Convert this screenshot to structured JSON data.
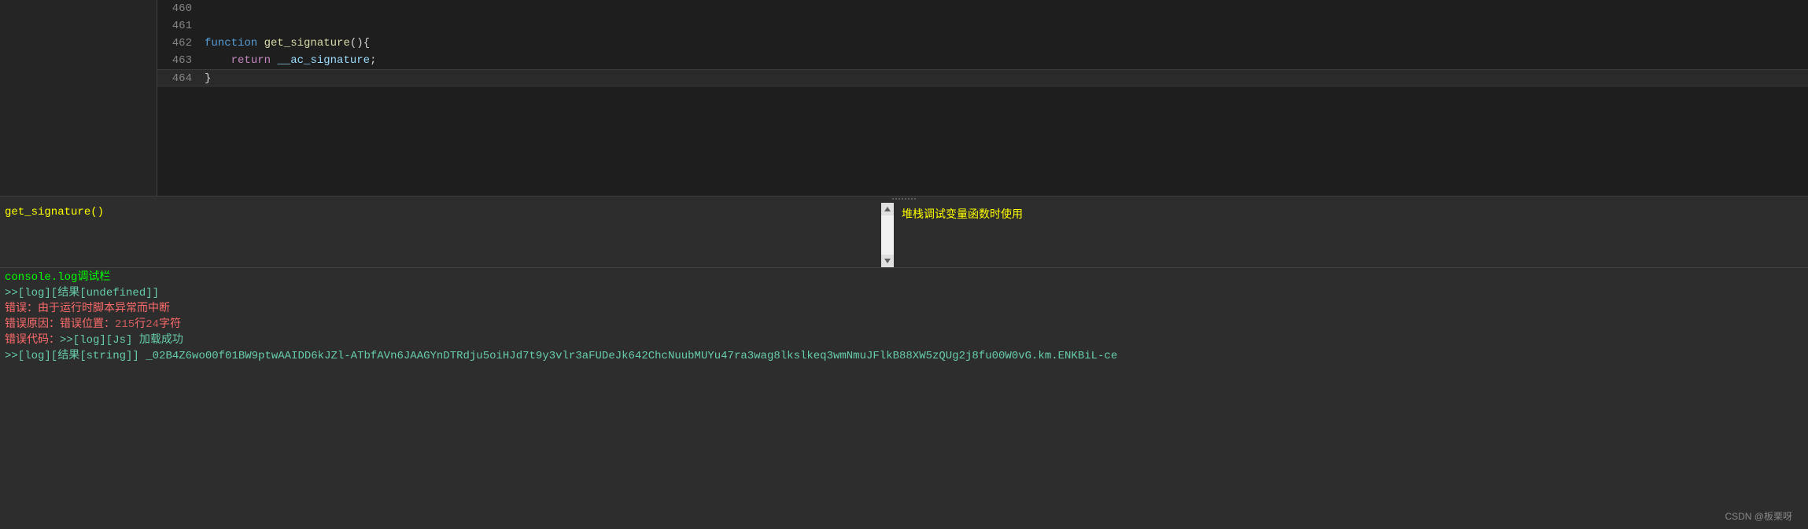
{
  "editor": {
    "lines": [
      {
        "num": "460",
        "content": ""
      },
      {
        "num": "461",
        "content": ""
      },
      {
        "num": "462",
        "tokens": [
          {
            "text": "function",
            "cls": "keyword"
          },
          {
            "text": " ",
            "cls": "punctuation"
          },
          {
            "text": "get_signature",
            "cls": "function-name"
          },
          {
            "text": "(){",
            "cls": "punctuation"
          }
        ]
      },
      {
        "num": "463",
        "tokens": [
          {
            "text": "    ",
            "cls": "punctuation"
          },
          {
            "text": "return",
            "cls": "return-keyword"
          },
          {
            "text": " ",
            "cls": "punctuation"
          },
          {
            "text": "__ac_signature",
            "cls": "identifier"
          },
          {
            "text": ";",
            "cls": "punctuation"
          }
        ]
      },
      {
        "num": "464",
        "tokens": [
          {
            "text": "}",
            "cls": "punctuation"
          }
        ],
        "highlighted": true
      }
    ]
  },
  "input_panel": {
    "value": "get_signature()"
  },
  "info_panel": {
    "text": "堆栈调试变量函数时使用"
  },
  "console": {
    "title": "console.log调试栏",
    "lines": [
      {
        "type": "log",
        "prefix": ">>[log][结果[undefined]]"
      },
      {
        "type": "error",
        "text": "错误：由于运行时脚本异常而中断"
      },
      {
        "type": "error",
        "prefix": "错误原因：错误位置：",
        "highlight": "215",
        "middle": "行",
        "highlight2": "24",
        "suffix": "字符"
      },
      {
        "type": "mixed",
        "prefix": "错误代码：",
        "log": ">>[log][Js] 加载成功"
      },
      {
        "type": "log",
        "prefix": ">>[log][结果[string]] ",
        "value": "_02B4Z6wo00f01BW9ptwAAIDD6kJZl-ATbfAVn6JAAGYnDTRdju5oiHJd7t9y3vlr3aFUDeJk642ChcNuubMUYu47ra3wag8lkslkeq3wmNmuJFlkB88XW5zQUg2j8fu00W0vG.km.ENKBiL-ce"
      }
    ]
  },
  "watermark": "CSDN @板栗呀"
}
